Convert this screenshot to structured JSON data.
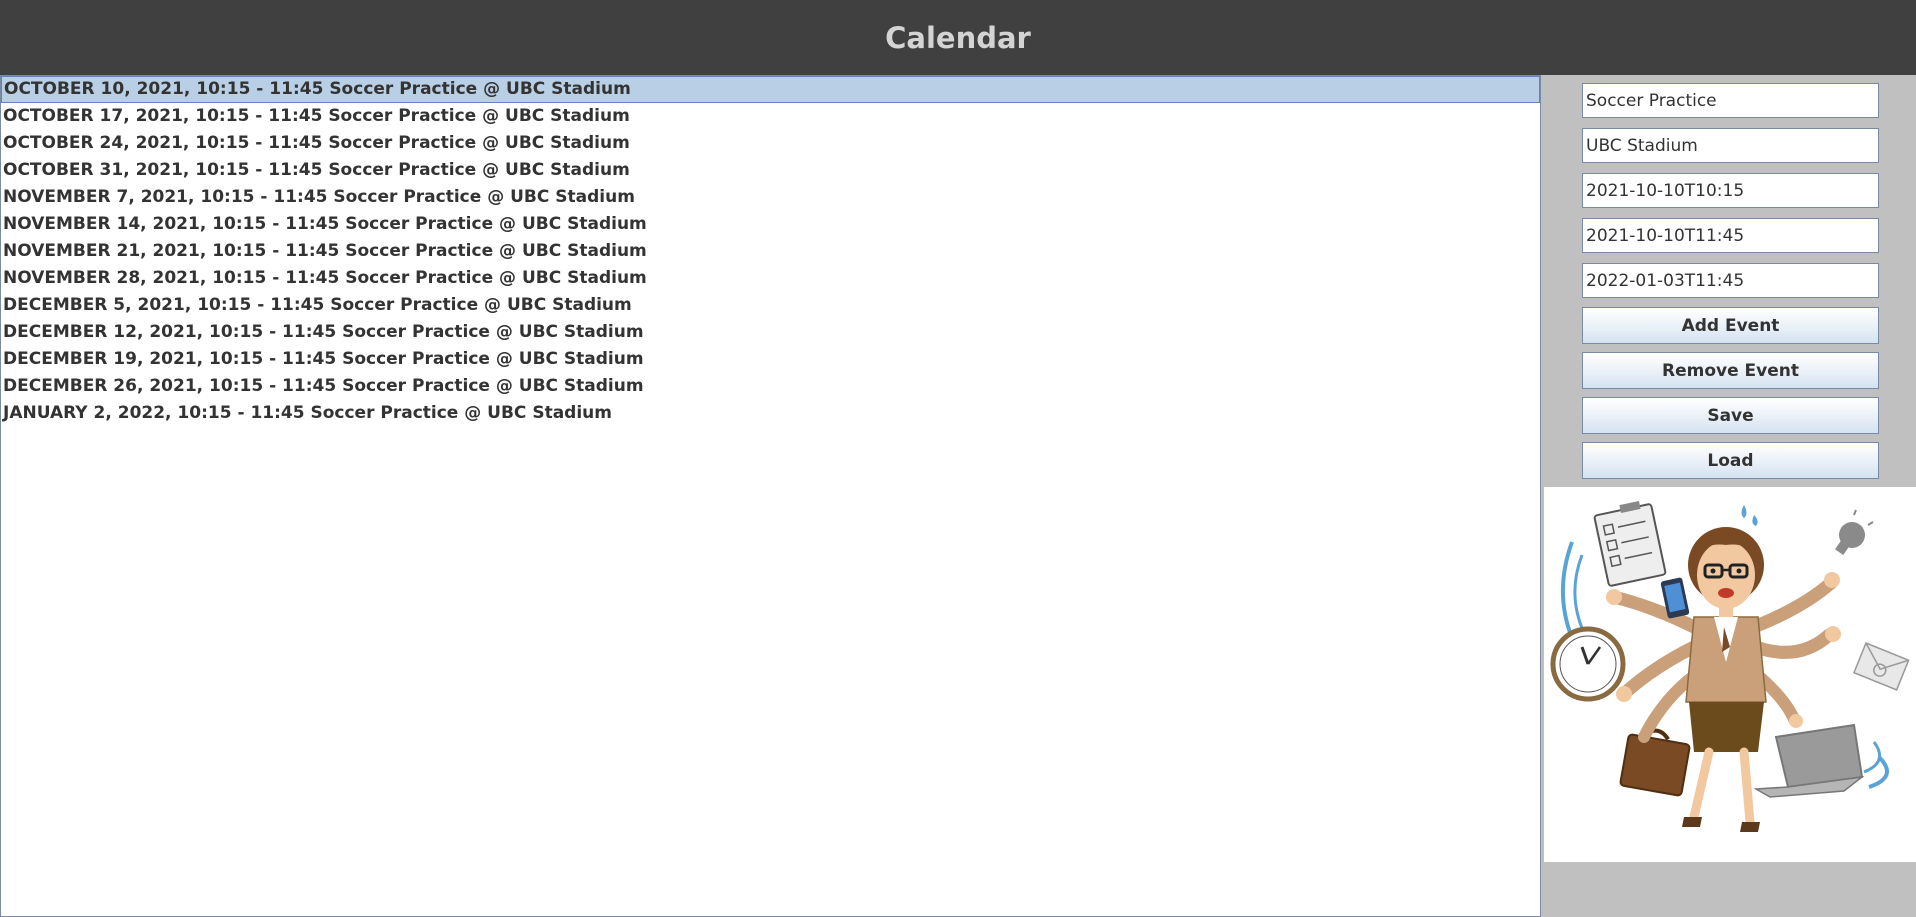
{
  "app": {
    "title": "Calendar"
  },
  "events": [
    "OCTOBER 10, 2021, 10:15 - 11:45 Soccer Practice @ UBC Stadium",
    "OCTOBER 17, 2021, 10:15 - 11:45 Soccer Practice @ UBC Stadium",
    "OCTOBER 24, 2021, 10:15 - 11:45 Soccer Practice @ UBC Stadium",
    "OCTOBER 31, 2021, 10:15 - 11:45 Soccer Practice @ UBC Stadium",
    "NOVEMBER 7, 2021, 10:15 - 11:45 Soccer Practice @ UBC Stadium",
    "NOVEMBER 14, 2021, 10:15 - 11:45 Soccer Practice @ UBC Stadium",
    "NOVEMBER 21, 2021, 10:15 - 11:45 Soccer Practice @ UBC Stadium",
    "NOVEMBER 28, 2021, 10:15 - 11:45 Soccer Practice @ UBC Stadium",
    "DECEMBER 5, 2021, 10:15 - 11:45 Soccer Practice @ UBC Stadium",
    "DECEMBER 12, 2021, 10:15 - 11:45 Soccer Practice @ UBC Stadium",
    "DECEMBER 19, 2021, 10:15 - 11:45 Soccer Practice @ UBC Stadium",
    "DECEMBER 26, 2021, 10:15 - 11:45 Soccer Practice @ UBC Stadium",
    "JANUARY 2, 2022, 10:15 - 11:45 Soccer Practice @ UBC Stadium"
  ],
  "form": {
    "event_name": "Soccer Practice",
    "location": "UBC Stadium",
    "start": "2021-10-10T10:15",
    "end": "2021-10-10T11:45",
    "repeat_until": "2022-01-03T11:45"
  },
  "buttons": {
    "add": "Add Event",
    "remove": "Remove Event",
    "save": "Save",
    "load": "Load"
  },
  "illustration": {
    "icon": "busy-multitasking-woman-illustration"
  }
}
